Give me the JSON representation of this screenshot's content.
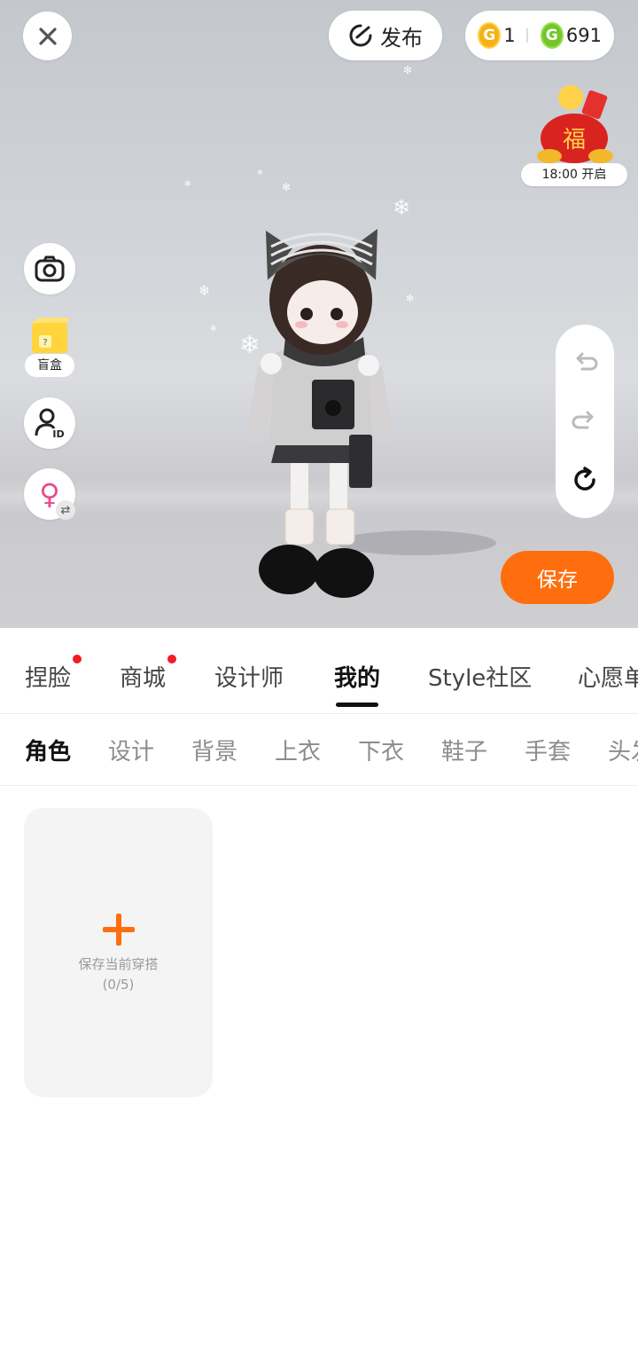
{
  "top_bar": {
    "publish_label": "发布",
    "gold_coin_value": "1",
    "green_coin_value": "691"
  },
  "event": {
    "label": "18:00 开启"
  },
  "left_tools": {
    "mystery_box_label": "盲盒",
    "gender_symbol": "♀"
  },
  "save_button_label": "保存",
  "main_tabs": [
    {
      "label": "捏脸",
      "dot": true
    },
    {
      "label": "商城",
      "dot": true
    },
    {
      "label": "设计师",
      "dot": false
    },
    {
      "label": "我的",
      "dot": false,
      "active": true
    },
    {
      "label": "Style社区",
      "dot": false
    },
    {
      "label": "心愿单",
      "dot": false
    }
  ],
  "sub_tabs": [
    {
      "label": "角色",
      "active": true
    },
    {
      "label": "设计"
    },
    {
      "label": "背景"
    },
    {
      "label": "上衣"
    },
    {
      "label": "下衣"
    },
    {
      "label": "鞋子"
    },
    {
      "label": "手套"
    },
    {
      "label": "头发"
    }
  ],
  "outfit_card": {
    "title": "保存当前穿搭",
    "count": "(0/5)"
  },
  "colors": {
    "accent": "#ff6e0e",
    "notification_dot": "#f21b26",
    "gender_icon": "#e84a8a"
  }
}
